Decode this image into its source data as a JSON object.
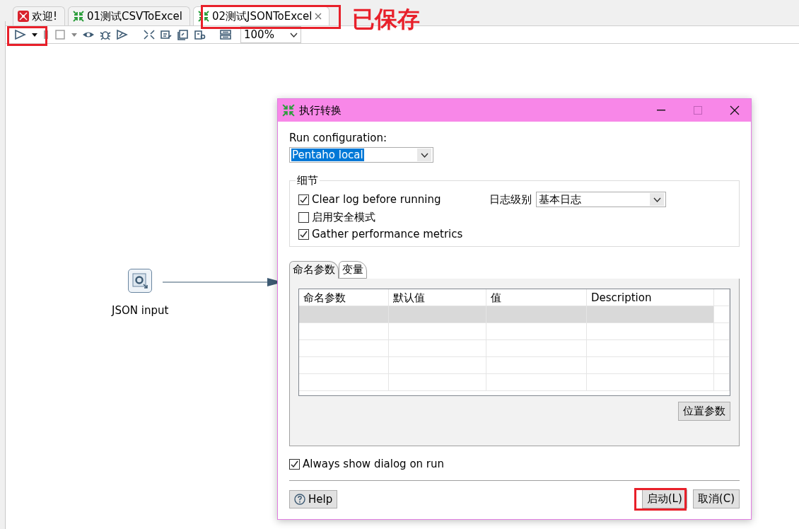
{
  "tabs": [
    {
      "label": "欢迎!",
      "kind": "welcome",
      "selected": false,
      "closable": false
    },
    {
      "label": "01测试CSVToExcel",
      "kind": "transform",
      "selected": false,
      "closable": false
    },
    {
      "label": "02测试JSONToExcel",
      "kind": "transform",
      "selected": true,
      "closable": true
    }
  ],
  "annotation": "已保存",
  "toolbar": {
    "zoom": "100%"
  },
  "canvas": {
    "nodes": [
      {
        "label": "JSON input"
      }
    ]
  },
  "dialog": {
    "title": "执行转换",
    "run_configuration_label": "Run configuration:",
    "run_configuration": "Pentaho local",
    "details": {
      "legend": "细节",
      "options": [
        {
          "label": "Clear log before running",
          "checked": true
        },
        {
          "label": "启用安全模式",
          "checked": false
        },
        {
          "label": "Gather performance metrics",
          "checked": true
        }
      ],
      "log_level_label": "日志级别",
      "log_level": "基本日志"
    },
    "tabs": [
      {
        "label": "命名参数",
        "selected": true
      },
      {
        "label": "变量",
        "selected": false
      }
    ],
    "table": {
      "columns": [
        "命名参数",
        "默认值",
        "值",
        "Description"
      ],
      "rows": [
        {
          "selected": true
        },
        {
          "selected": false
        },
        {
          "selected": false
        },
        {
          "selected": false
        },
        {
          "selected": false
        }
      ]
    },
    "position_params_button": "位置参数",
    "always_show": {
      "label": "Always show dialog on run",
      "checked": true
    },
    "help_button": "Help",
    "launch_button": "启动(L)",
    "cancel_button": "取消(C)"
  }
}
